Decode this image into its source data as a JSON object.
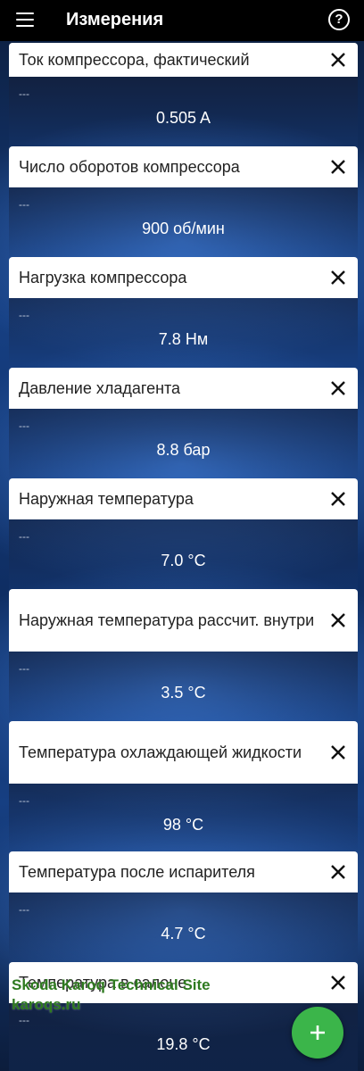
{
  "appbar": {
    "title": "Измерения",
    "menu_icon": "menu-icon",
    "help_icon": "help-icon",
    "help_glyph": "?"
  },
  "measurements": [
    {
      "title": "Ток компрессора, фактический",
      "previous": "---",
      "value": "0.505 A"
    },
    {
      "title": "Число оборотов компрессора",
      "previous": "---",
      "value": "900 об/мин"
    },
    {
      "title": "Нагрузка компрессора",
      "previous": "---",
      "value": "7.8 Нм"
    },
    {
      "title": "Давление хладагента",
      "previous": "---",
      "value": "8.8 бар"
    },
    {
      "title": "Наружная температура",
      "previous": "---",
      "value": "7.0 °C"
    },
    {
      "title": "Наружная температура рассчит. внутри",
      "previous": "---",
      "value": "3.5 °C"
    },
    {
      "title": "Температура охлаждающей жидкости",
      "previous": "---",
      "value": "98 °C"
    },
    {
      "title": "Температура после испарителя",
      "previous": "---",
      "value": "4.7 °C"
    },
    {
      "title": "Температура в салоне",
      "previous": "---",
      "value": "19.8 °C"
    }
  ],
  "watermark": {
    "line1": "Skoda Karoq Technical Site",
    "line2": "karoqs.ru"
  },
  "fab": {
    "icon": "plus-icon"
  },
  "colors": {
    "appbar": "#000000",
    "fab": "#3bb54a",
    "watermark": "#2e7a1f"
  }
}
